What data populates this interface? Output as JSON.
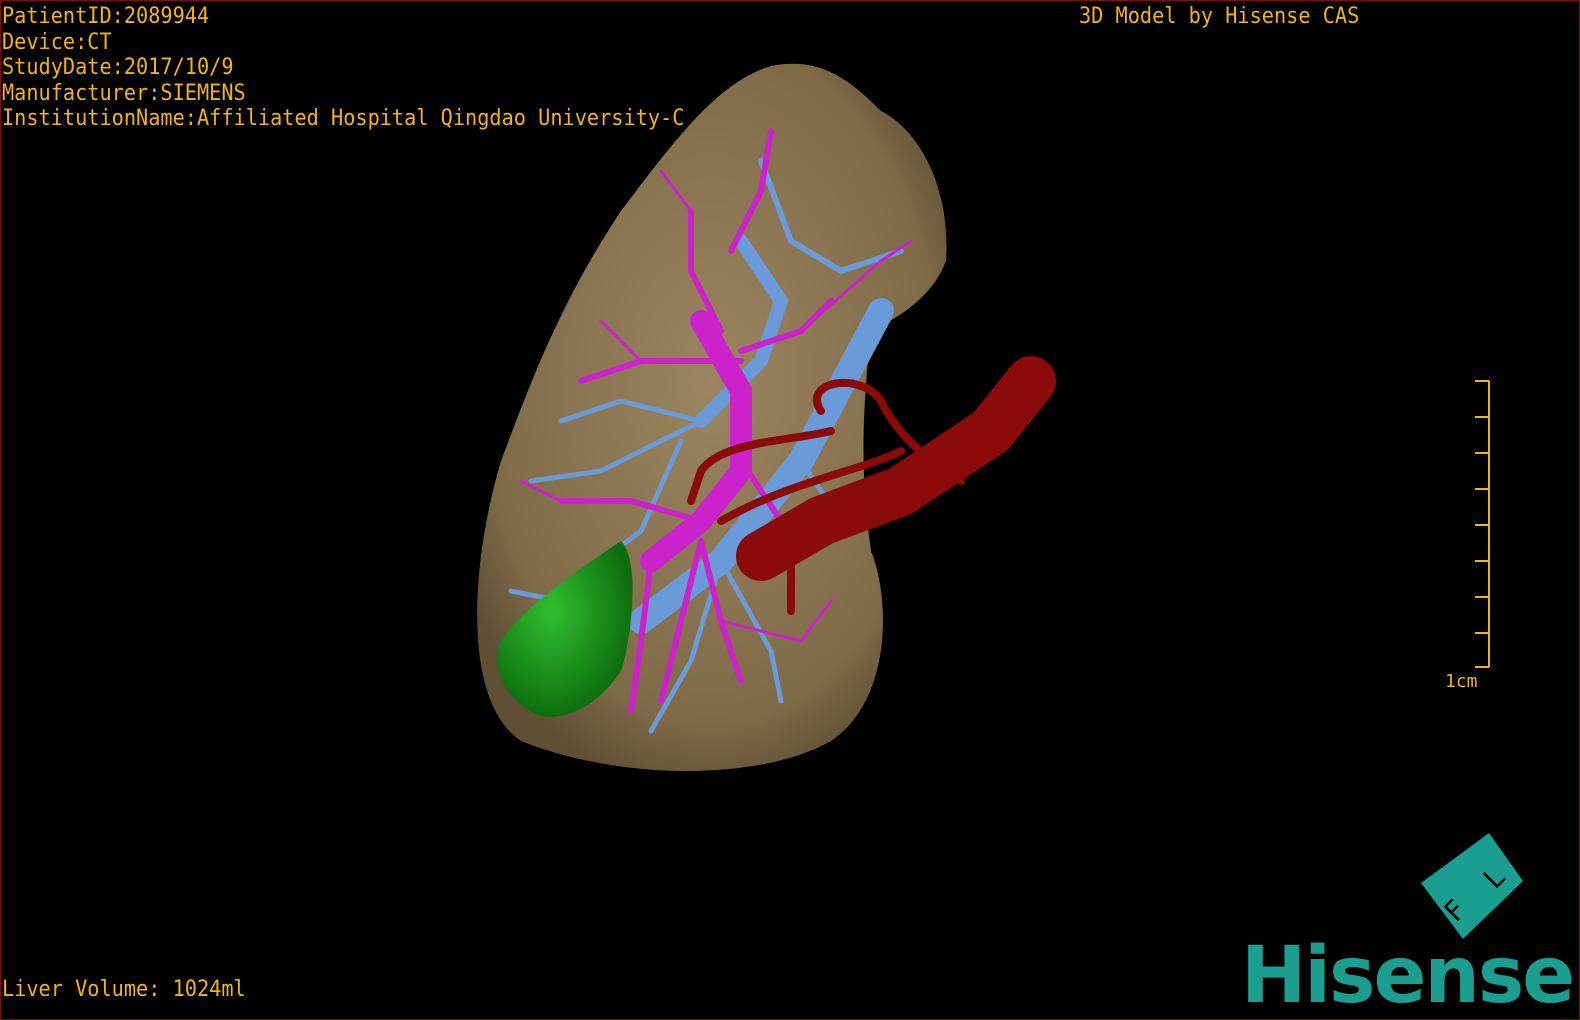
{
  "info": {
    "patient_id": "PatientID:2089944",
    "device": "Device:CT",
    "study_date": "StudyDate:2017/10/9",
    "manufacturer": "Manufacturer:SIEMENS",
    "institution": "InstitutionName:Affiliated Hospital Qingdao University-C"
  },
  "credit": "3D Model by Hisense CAS",
  "liver_volume": "Liver Volume: 1024ml",
  "scale_bar": {
    "label": "1cm"
  },
  "logo": {
    "brand": "Hisense",
    "cube_letters": "F L",
    "color": "#1a9e90"
  },
  "colors": {
    "text": "#f2b418",
    "liver": "#8c7552",
    "portal_vein": "#cc22cc",
    "hepatic_vein": "#6a9ad8",
    "artery": "#8b0a0a",
    "gallbladder": "#1a9a1a"
  }
}
